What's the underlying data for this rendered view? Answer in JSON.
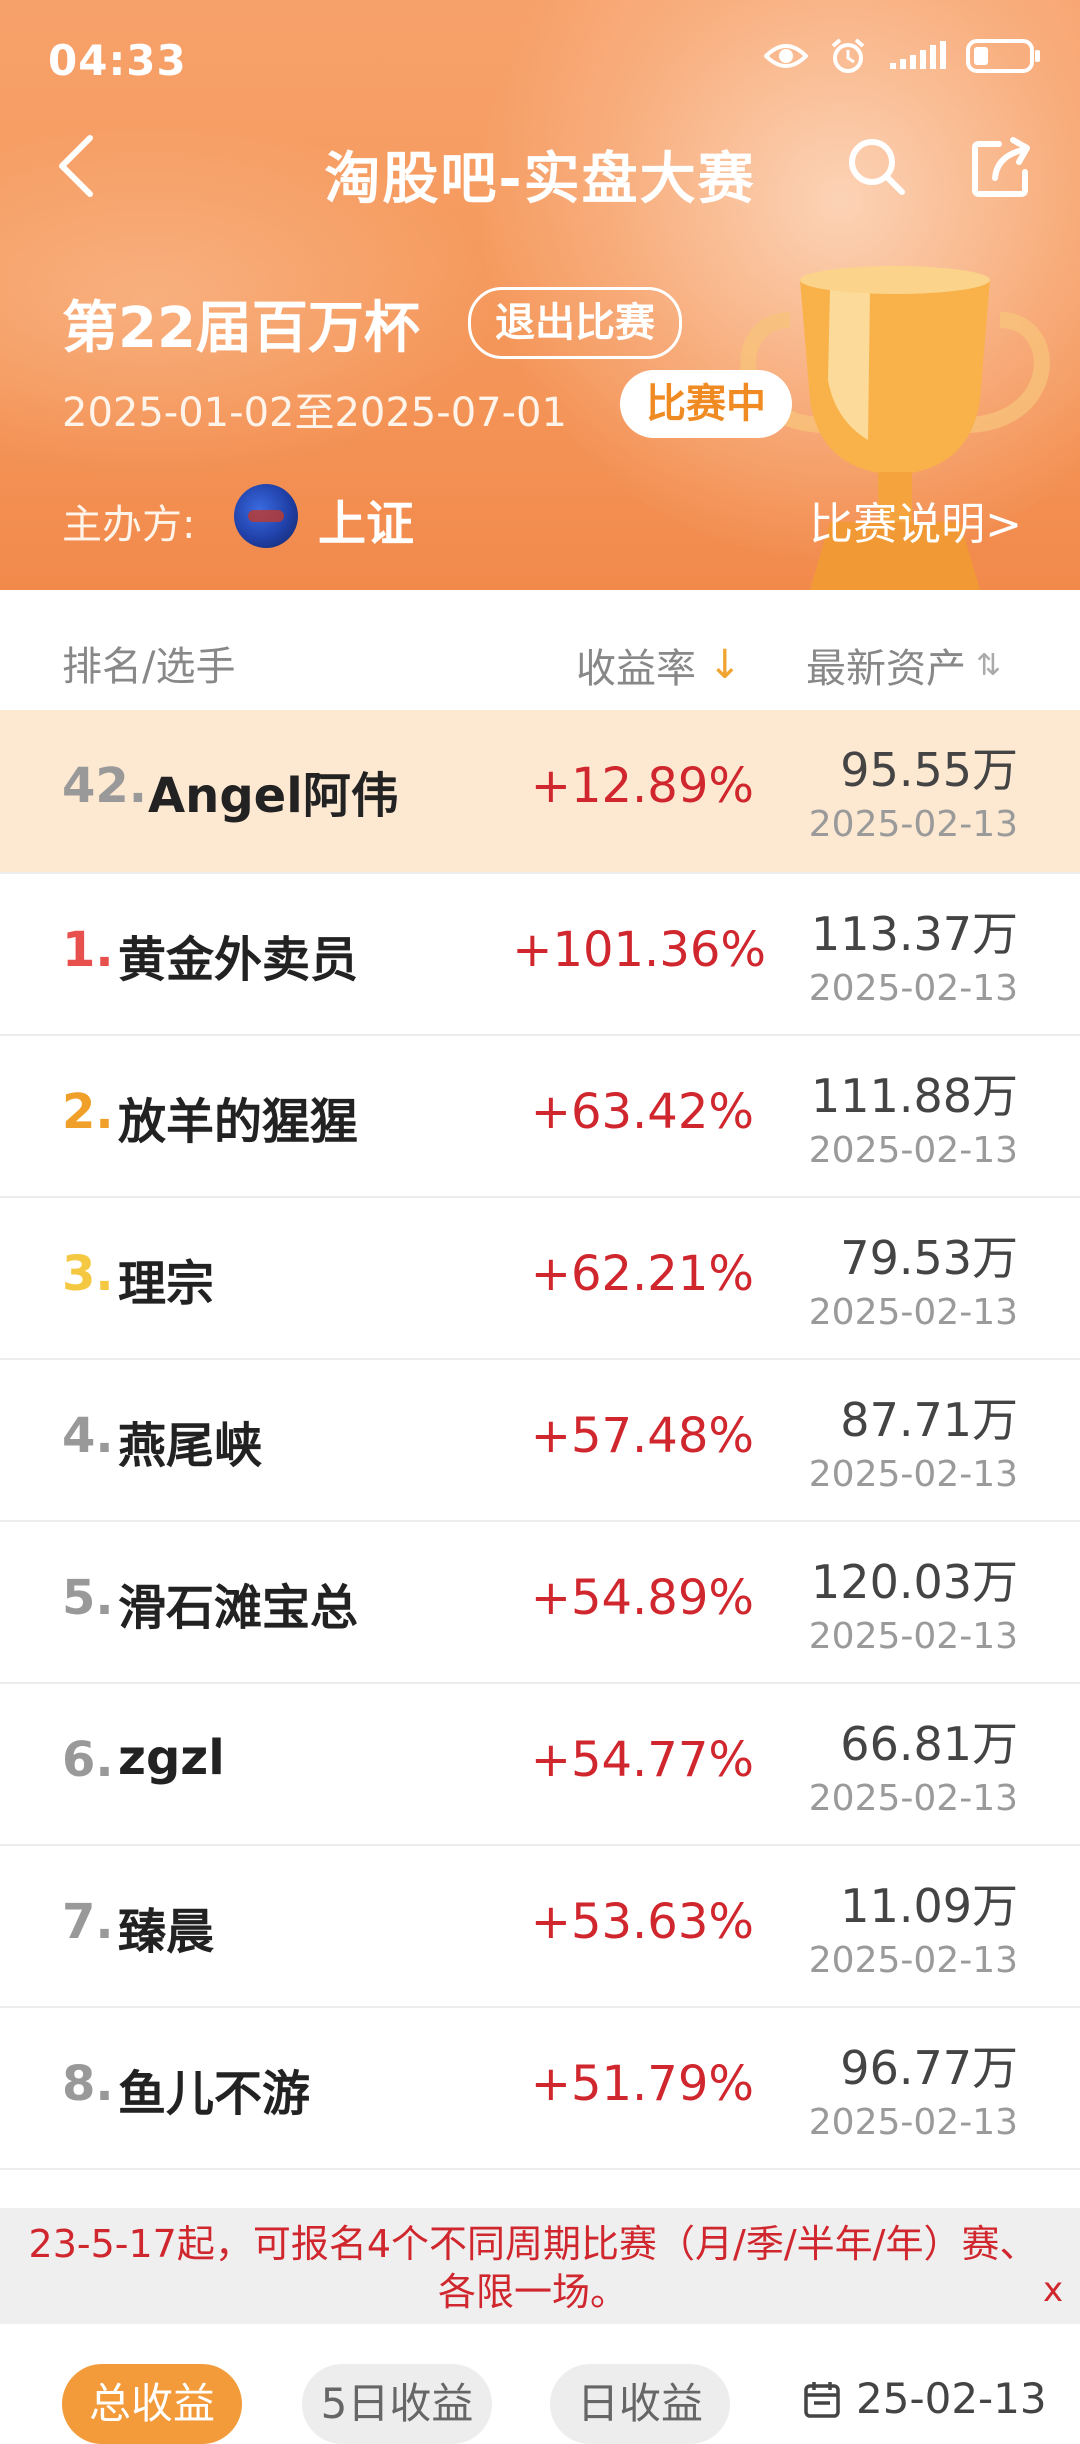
{
  "status_bar": {
    "time": "04:33"
  },
  "header": {
    "title": "淘股吧-实盘大赛",
    "contest_name": "第22届百万杯",
    "exit_label": "退出比赛",
    "date_range": "2025-01-02至2025-07-01",
    "state_label": "比赛中",
    "organizer_label": "主办方:",
    "organizer_name": "上证",
    "rules_label": "比赛说明>"
  },
  "table_header": {
    "rank_player": "排名/选手",
    "return_rate": "收益率",
    "latest_assets": "最新资产"
  },
  "my_row": {
    "rank": "42.",
    "name": "Angel阿伟",
    "rate": "+12.89%",
    "assets": "95.55万",
    "date": "2025-02-13"
  },
  "rows": [
    {
      "rank": "1.",
      "name": "黄金外卖员",
      "rate": "+101.36%",
      "assets": "113.37万",
      "date": "2025-02-13"
    },
    {
      "rank": "2.",
      "name": "放羊的猩猩",
      "rate": "+63.42%",
      "assets": "111.88万",
      "date": "2025-02-13"
    },
    {
      "rank": "3.",
      "name": "理宗",
      "rate": "+62.21%",
      "assets": "79.53万",
      "date": "2025-02-13"
    },
    {
      "rank": "4.",
      "name": "燕尾峡",
      "rate": "+57.48%",
      "assets": "87.71万",
      "date": "2025-02-13"
    },
    {
      "rank": "5.",
      "name": "滑石滩宝总",
      "rate": "+54.89%",
      "assets": "120.03万",
      "date": "2025-02-13"
    },
    {
      "rank": "6.",
      "name": "zgzl",
      "rate": "+54.77%",
      "assets": "66.81万",
      "date": "2025-02-13"
    },
    {
      "rank": "7.",
      "name": "臻晨",
      "rate": "+53.63%",
      "assets": "11.09万",
      "date": "2025-02-13"
    },
    {
      "rank": "8.",
      "name": "鱼儿不游",
      "rate": "+51.79%",
      "assets": "96.77万",
      "date": "2025-02-13"
    }
  ],
  "notice": {
    "text": "23-5-17起，可报名4个不同周期比赛（月/季/半年/年）赛、各限一场。",
    "close": "x"
  },
  "bottom_tabs": {
    "total": "总收益",
    "five_day": "5日收益",
    "daily": "日收益",
    "date_filter": "25-02-13"
  },
  "colors": {
    "accent": "#f39b3a",
    "positive": "#d0262d",
    "header_bg": "#f59a5e"
  }
}
